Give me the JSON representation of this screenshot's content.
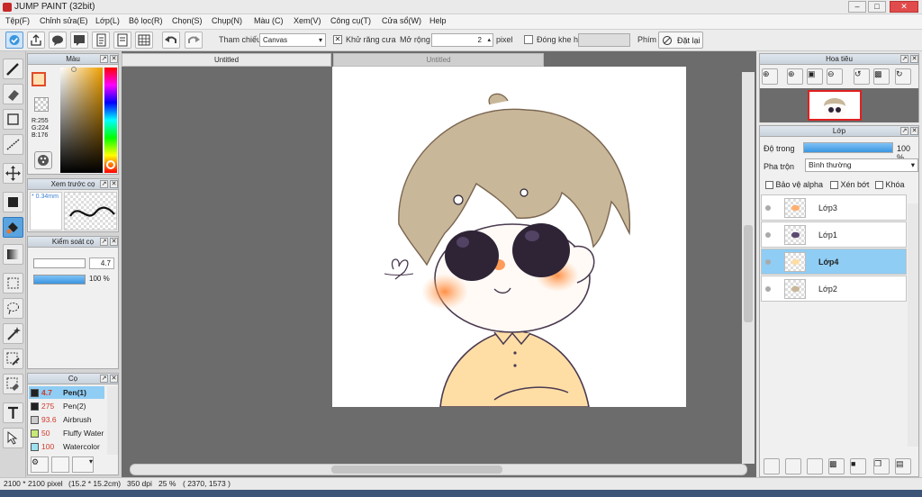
{
  "window": {
    "title": "JUMP PAINT (32bit)"
  },
  "menu": [
    "Tệp(F)",
    "Chỉnh sửa(E)",
    "Lớp(L)",
    "Bộ lọc(R)",
    "Chọn(S)",
    "Chụp(N)",
    "Màu (C)",
    "Xem(V)",
    "Công cụ(T)",
    "Cửa sổ(W)",
    "Help"
  ],
  "toolbar": {
    "reference_label": "Tham chiếu",
    "reference_value": "Canvas",
    "antialias_label": "Khử răng cưa",
    "expand_label": "Mở rộng",
    "expand_value": "2",
    "expand_unit": "pixel",
    "close_gap_label": "Đóng khe hở",
    "keys_label": "Phím",
    "reset_label": "Đặt lại"
  },
  "color_panel": {
    "title": "Màu",
    "r": "R:255",
    "g": "G:224",
    "b": "B:176",
    "fg_color": "#ffe0b0"
  },
  "brush_preview": {
    "title": "Xem trước cọ",
    "size": "0.34mm"
  },
  "brush_control": {
    "title": "Kiểm soát cọ",
    "size_value": "4.7",
    "opacity_value": "100 %",
    "opacity_fraction": 1.0
  },
  "brushes_panel": {
    "title": "Cọ",
    "items": [
      {
        "size": "4.7",
        "name": "Pen(1)",
        "color": "#222222",
        "selected": true
      },
      {
        "size": "275",
        "name": "Pen(2)",
        "color": "#222222",
        "selected": false
      },
      {
        "size": "93.6",
        "name": "Airbrush",
        "color": "#cccccc",
        "selected": false
      },
      {
        "size": "50",
        "name": "Fluffy Water",
        "color": "#c8e878",
        "selected": false
      },
      {
        "size": "100",
        "name": "Watercolor",
        "color": "#9ee0f0",
        "selected": false
      }
    ]
  },
  "tabs": [
    "Untitled",
    "Untitled"
  ],
  "navigator": {
    "title": "Hoa tiêu"
  },
  "layers_panel": {
    "title": "Lớp",
    "opacity_label": "Độ trong",
    "opacity_value": "100 %",
    "opacity_fraction": 1.0,
    "blend_label": "Pha trộn",
    "blend_value": "Bình thường",
    "protect_alpha_label": "Bảo vệ alpha",
    "clipping_label": "Xén bớt",
    "lock_label": "Khóa",
    "layers": [
      {
        "name": "Lớp3",
        "selected": false
      },
      {
        "name": "Lớp1",
        "selected": false
      },
      {
        "name": "Lớp4",
        "selected": true
      },
      {
        "name": "Lớp2",
        "selected": false
      }
    ]
  },
  "status": {
    "size": "2100 * 2100 pixel",
    "physical": "(15.2 * 15.2cm)",
    "dpi": "350 dpi",
    "zoom": "25 %",
    "coords": "( 2370, 1573 )"
  },
  "colors": {
    "accent": "#3b96e0",
    "selected_layer": "#8fcdf4",
    "hair": "#c9b79a",
    "skin": "#fff4ea",
    "sweater": "#ffdfaa",
    "blush": "#ff9a55"
  }
}
